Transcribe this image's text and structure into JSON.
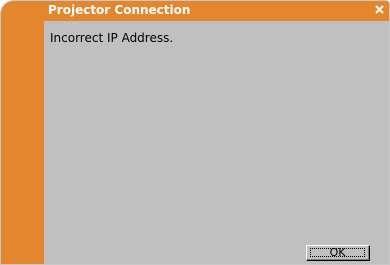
{
  "window": {
    "title": "Projector Connection",
    "accent_color": "#e4862e",
    "body_color": "#c0c0c0"
  },
  "titlebar": {
    "close_icon": "close-icon"
  },
  "message": {
    "text": "Incorrect IP Address."
  },
  "buttons": {
    "ok_label": "OK"
  }
}
